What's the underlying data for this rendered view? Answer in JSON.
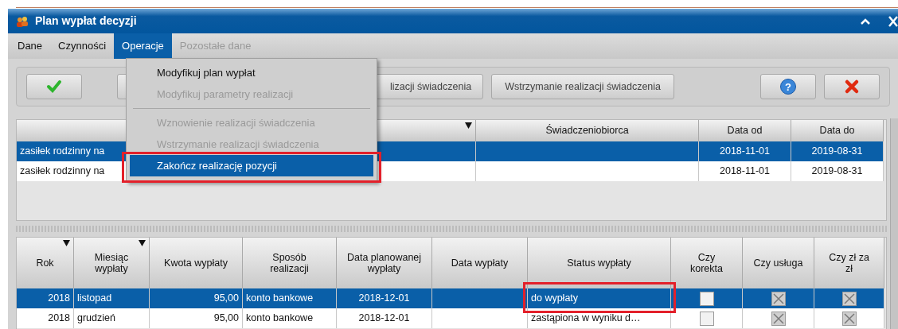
{
  "window": {
    "title": "Plan wypłat decyzji"
  },
  "menu_bar": [
    {
      "label": "Dane",
      "selected": false,
      "disabled": false
    },
    {
      "label": "Czynności",
      "selected": false,
      "disabled": false
    },
    {
      "label": "Operacje",
      "selected": true,
      "disabled": false
    },
    {
      "label": "Pozostałe dane",
      "selected": false,
      "disabled": true
    }
  ],
  "dropdown_menu": [
    {
      "label": "Modyfikuj plan wypłat",
      "disabled": false,
      "selected": false,
      "separator_before": false
    },
    {
      "label": "Modyfikuj parametry realizacji",
      "disabled": true,
      "selected": false,
      "separator_before": false
    },
    {
      "label": "Wznowienie realizacji świadczenia",
      "disabled": true,
      "selected": false,
      "separator_before": true
    },
    {
      "label": "Wstrzymanie realizacji świadczenia",
      "disabled": true,
      "selected": false,
      "separator_before": false
    },
    {
      "label": "Zakończ realizację pozycji",
      "disabled": false,
      "selected": true,
      "separator_before": false,
      "highlighted_frame": true
    }
  ],
  "toolbar": [
    {
      "kind": "ok"
    },
    {
      "kind": "hidden"
    },
    {
      "kind": "text",
      "label": "lizacji świadczenia"
    },
    {
      "kind": "text",
      "label": "Wstrzymanie realizacji świadczenia"
    },
    {
      "kind": "help",
      "label": "?"
    },
    {
      "kind": "cancel"
    }
  ],
  "upper_table": {
    "columns": [
      {
        "sort": true
      },
      {
        "label": "Świadczeniobiorca",
        "sort": false
      },
      {
        "label": "Data od",
        "sort": false
      },
      {
        "label": "Data do",
        "sort": false
      }
    ],
    "rows": [
      {
        "selected": true,
        "cells": [
          "zasiłek rodzinny na",
          "",
          "2018-11-01",
          "2019-08-31"
        ]
      },
      {
        "selected": false,
        "cells": [
          "zasiłek rodzinny na",
          "",
          "2018-11-01",
          "2019-08-31"
        ]
      }
    ]
  },
  "lower_table": {
    "columns": [
      {
        "label": "Rok",
        "sort": true
      },
      {
        "label": "Miesiąc wypłaty",
        "sort": true
      },
      {
        "label": "Kwota wypłaty",
        "sort": false
      },
      {
        "label": "Sposób realizacji",
        "sort": false
      },
      {
        "label": "Data planowanej wypłaty",
        "sort": false
      },
      {
        "label": "Data wypłaty",
        "sort": false
      },
      {
        "label": "Status wypłaty",
        "sort": false
      },
      {
        "label": "Czy korekta",
        "sort": false
      },
      {
        "label": "Czy usługa",
        "sort": false
      },
      {
        "label": "Czy zł za zł",
        "sort": false
      }
    ],
    "rows": [
      {
        "selected": true,
        "rok": "2018",
        "miesiac": "listopad",
        "kwota": "95,00",
        "sposob": "konto bankowe",
        "data_planowana": "2018-12-01",
        "data_wyplaty": "",
        "status": "do wypłaty",
        "status_highlighted": true,
        "korekta": false,
        "usluga": true,
        "zl_za_zl": true
      },
      {
        "selected": false,
        "rok": "2018",
        "miesiac": "grudzień",
        "kwota": "95,00",
        "sposob": "konto bankowe",
        "data_planowana": "2018-12-01",
        "data_wyplaty": "",
        "status": "zastąpiona w wyniku d…",
        "status_highlighted": false,
        "korekta": false,
        "usluga": true,
        "zl_za_zl": true
      }
    ]
  }
}
